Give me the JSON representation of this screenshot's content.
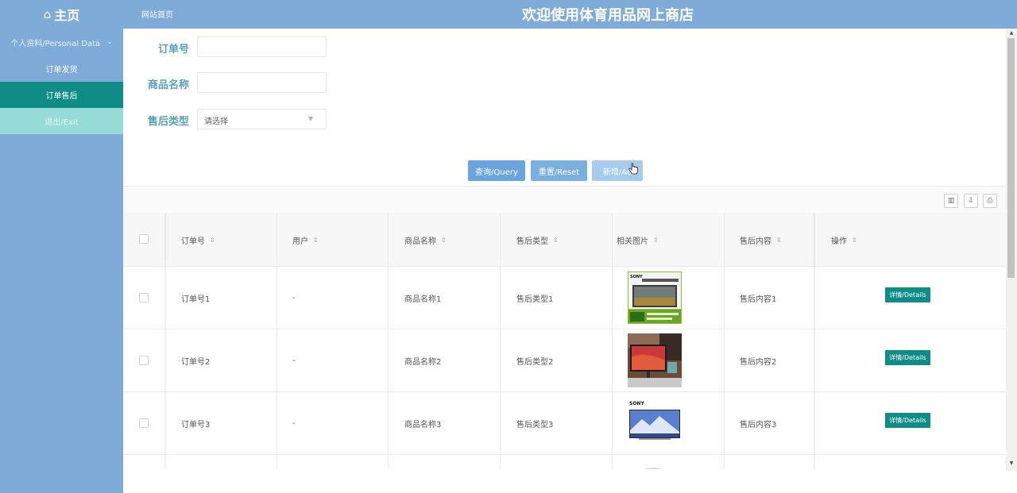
{
  "header": {
    "brand": "主页",
    "site_link": "网站首页",
    "title": "欢迎使用体育用品网上商店",
    "color": "#7fabd8"
  },
  "sidebar": {
    "group_label": "个人资料/Personal Data",
    "items": [
      {
        "label": "订单发货"
      },
      {
        "label": "订单售后"
      },
      {
        "label": "退出/Exit"
      }
    ],
    "active_color": "#0e8c85"
  },
  "form": {
    "order_no_label": "订单号",
    "order_no_value": "",
    "product_name_label": "商品名称",
    "product_name_value": "",
    "aftersale_type_label": "售后类型",
    "aftersale_type_placeholder": "请选择"
  },
  "actions": {
    "query": "查询/Query",
    "reset": "重置/Reset",
    "add": "新增/Ad"
  },
  "table": {
    "headers": [
      "订单号",
      "用户",
      "商品名称",
      "售后类型",
      "相关图片",
      "售后内容",
      "操作"
    ],
    "rows": [
      {
        "order_no": "订单号1",
        "user": "-",
        "product": "商品名称1",
        "type": "售后类型1",
        "content": "售后内容1",
        "image": "sony-tv-box",
        "detail": "详情/Details"
      },
      {
        "order_no": "订单号2",
        "user": "-",
        "product": "商品名称2",
        "type": "售后类型2",
        "content": "售后内容2",
        "image": "monitor-photo",
        "detail": "详情/Details"
      },
      {
        "order_no": "订单号3",
        "user": "-",
        "product": "商品名称3",
        "type": "售后类型3",
        "content": "售后内容3",
        "image": "sony-tv-mountain",
        "detail": "详情/Details"
      }
    ],
    "image_brand": "SONY"
  }
}
